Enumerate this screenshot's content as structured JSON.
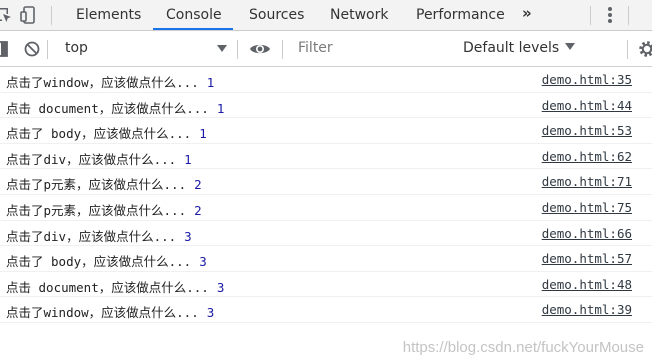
{
  "tabs": [
    "Elements",
    "Console",
    "Sources",
    "Network",
    "Performance"
  ],
  "active_tab": "Console",
  "more_tabs_label": "»",
  "filterbar": {
    "context": "top",
    "filter_placeholder": "Filter",
    "levels_label": "Default levels"
  },
  "messages": [
    {
      "text": "点击了window，应该做点什么...",
      "count": "1",
      "source": "demo.html:35"
    },
    {
      "text": "点击 document，应该做点什么...",
      "count": "1",
      "source": "demo.html:44"
    },
    {
      "text": "点击了 body，应该做点什么...",
      "count": "1",
      "source": "demo.html:53"
    },
    {
      "text": "点击了div，应该做点什么...",
      "count": "1",
      "source": "demo.html:62"
    },
    {
      "text": "点击了p元素，应该做点什么...",
      "count": "2",
      "source": "demo.html:71"
    },
    {
      "text": "点击了p元素，应该做点什么...",
      "count": "2",
      "source": "demo.html:75"
    },
    {
      "text": "点击了div，应该做点什么...",
      "count": "3",
      "source": "demo.html:66"
    },
    {
      "text": "点击了 body，应该做点什么...",
      "count": "3",
      "source": "demo.html:57"
    },
    {
      "text": "点击 document，应该做点什么...",
      "count": "3",
      "source": "demo.html:48"
    },
    {
      "text": "点击了window，应该做点什么...",
      "count": "3",
      "source": "demo.html:39"
    }
  ],
  "watermark": "https://blog.csdn.net/fuckYourMouse",
  "colors": {
    "active_tab_underline": "#1a73e8",
    "log_number": "#1a1aa6"
  },
  "icons": [
    "inspect-element-icon",
    "device-toolbar-icon",
    "more-tabs-icon",
    "kebab-menu-icon",
    "show-sidebar-icon",
    "clear-console-icon",
    "live-expression-eye-icon",
    "settings-gear-icon"
  ]
}
